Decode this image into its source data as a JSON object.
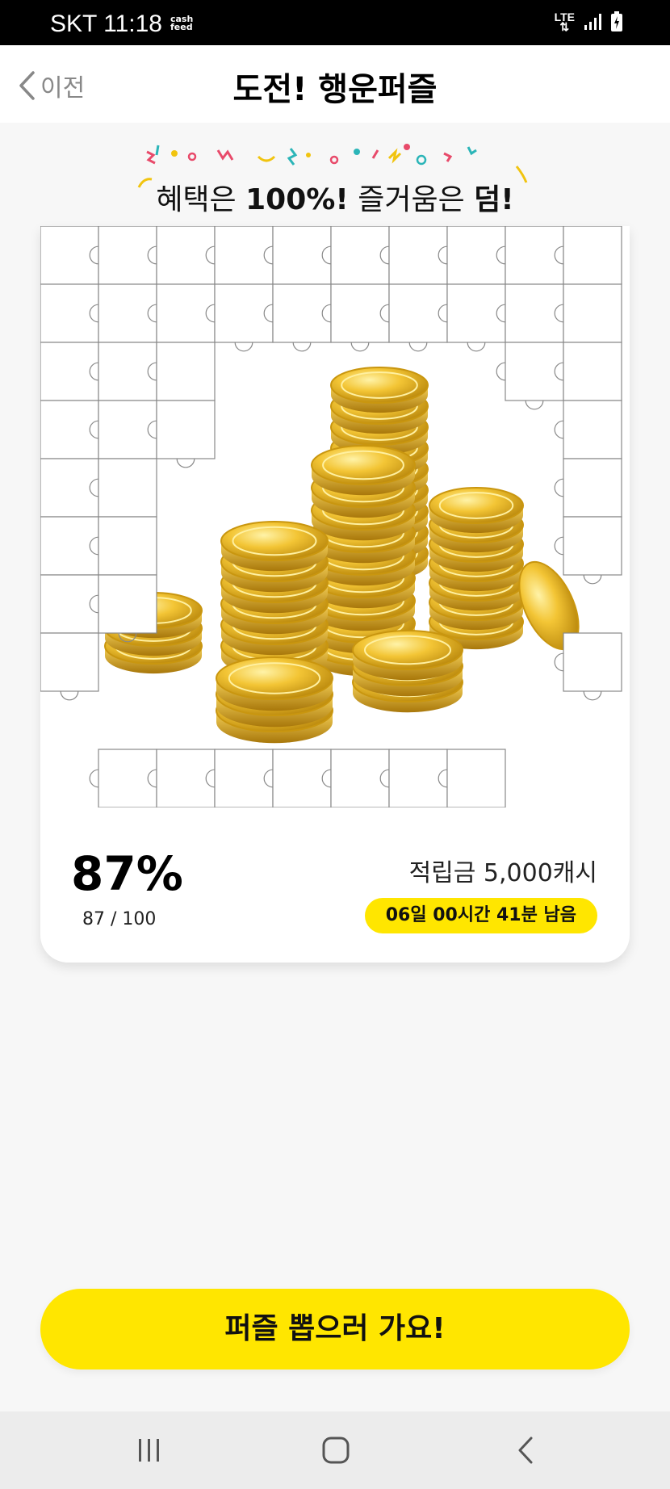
{
  "status_bar": {
    "carrier_time": "SKT 11:18",
    "logo_line1": "cash",
    "logo_line2": "feed",
    "network": "LTE"
  },
  "header": {
    "back_label": "이전",
    "title": "도전! 행운퍼즐"
  },
  "tagline": {
    "part1": "혜택은 ",
    "part2": "100%!",
    "part3": " 즐거움은 ",
    "part4": "덤!"
  },
  "puzzle": {
    "progress_percent": "87%",
    "progress_count": "87 / 100",
    "pieces_collected": 87,
    "pieces_total": 100
  },
  "reward": {
    "label": "적립금 5,000캐시",
    "time_left": "06일 00시간 41분 남음"
  },
  "cta": {
    "label": "퍼즐 뽑으러 가요!"
  },
  "colors": {
    "accent_yellow": "#ffe600",
    "gold": "#e8b51b"
  }
}
